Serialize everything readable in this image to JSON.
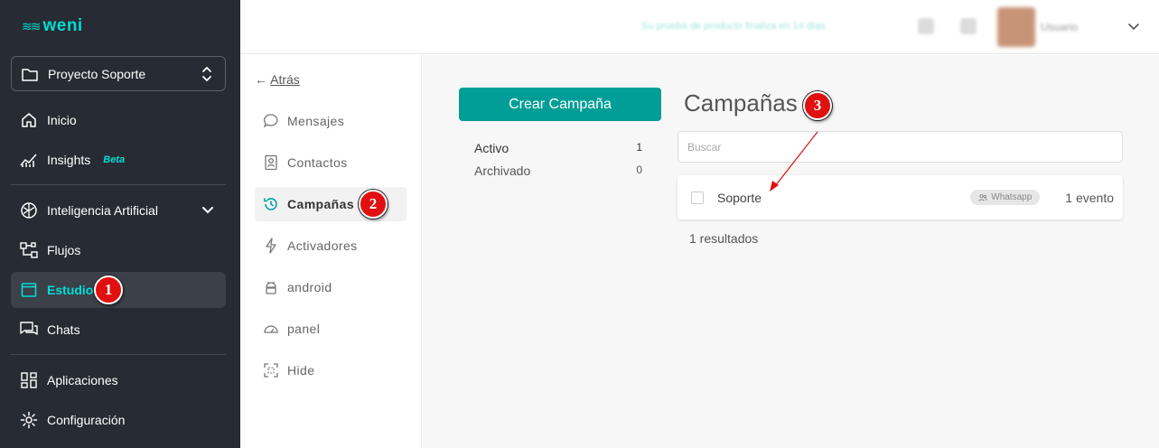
{
  "brand": {
    "logo_text": "weni",
    "accent": "#00ded3"
  },
  "sidebar": {
    "project_label": "Proyecto Soporte",
    "items": [
      {
        "label": "Inicio",
        "icon": "home-icon"
      },
      {
        "label": "Insights",
        "badge": "Beta",
        "icon": "chart-icon"
      },
      {
        "label": "Inteligencia Artificial",
        "icon": "brain-icon"
      },
      {
        "label": "Flujos",
        "icon": "flow-icon"
      },
      {
        "label": "Estudio",
        "icon": "studio-icon",
        "active": true
      },
      {
        "label": "Chats",
        "icon": "chat-icon"
      },
      {
        "label": "Aplicaciones",
        "icon": "apps-icon"
      },
      {
        "label": "Configuración",
        "icon": "gear-icon"
      }
    ]
  },
  "topbar": {
    "notice": "Su prueba de producto finaliza en 14 días",
    "user_name": "Usuario"
  },
  "subnav": {
    "back_label": "Atrás",
    "items": [
      {
        "label": "Mensajes",
        "icon": "message-icon"
      },
      {
        "label": "Contactos",
        "icon": "contact-icon"
      },
      {
        "label": "Campañas",
        "icon": "campaign-icon",
        "active": true
      },
      {
        "label": "Activadores",
        "icon": "bolt-icon"
      },
      {
        "label": "android",
        "icon": "android-icon"
      },
      {
        "label": "panel",
        "icon": "gauge-icon"
      },
      {
        "label": "Hide",
        "icon": "hide-icon"
      }
    ]
  },
  "main": {
    "create_button": "Crear Campaña",
    "filters": [
      {
        "label": "Activo",
        "count": "1"
      },
      {
        "label": "Archivado",
        "count": "0"
      }
    ],
    "title": "Campañas",
    "search_placeholder": "Buscar",
    "campaigns": [
      {
        "name": "Soporte",
        "channel": "Whatsapp",
        "events": "1 evento"
      }
    ],
    "results_text": "1 resultados"
  },
  "annotations": [
    "1",
    "2",
    "3"
  ],
  "colors": {
    "sidebar_bg": "#272b33",
    "primary_button": "#009e96",
    "marker": "#e01010"
  }
}
